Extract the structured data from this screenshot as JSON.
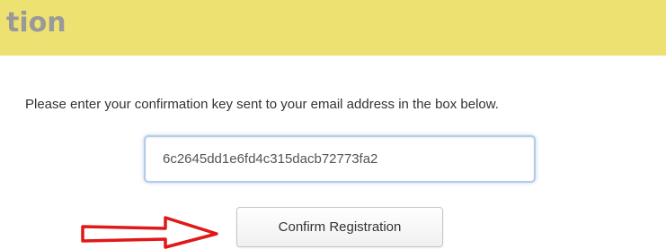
{
  "header": {
    "title": "tion",
    "band_color": "#ede172"
  },
  "instruction_text": "Please enter your confirmation key sent to your email address in the box below.",
  "confirmation_input": {
    "value": "6c2645dd1e6fd4c315dacb72773fa2"
  },
  "confirm_button": {
    "label": "Confirm Registration"
  },
  "annotation": {
    "arrow_icon": "red-outline-arrow-right",
    "arrow_color": "#e01818"
  }
}
